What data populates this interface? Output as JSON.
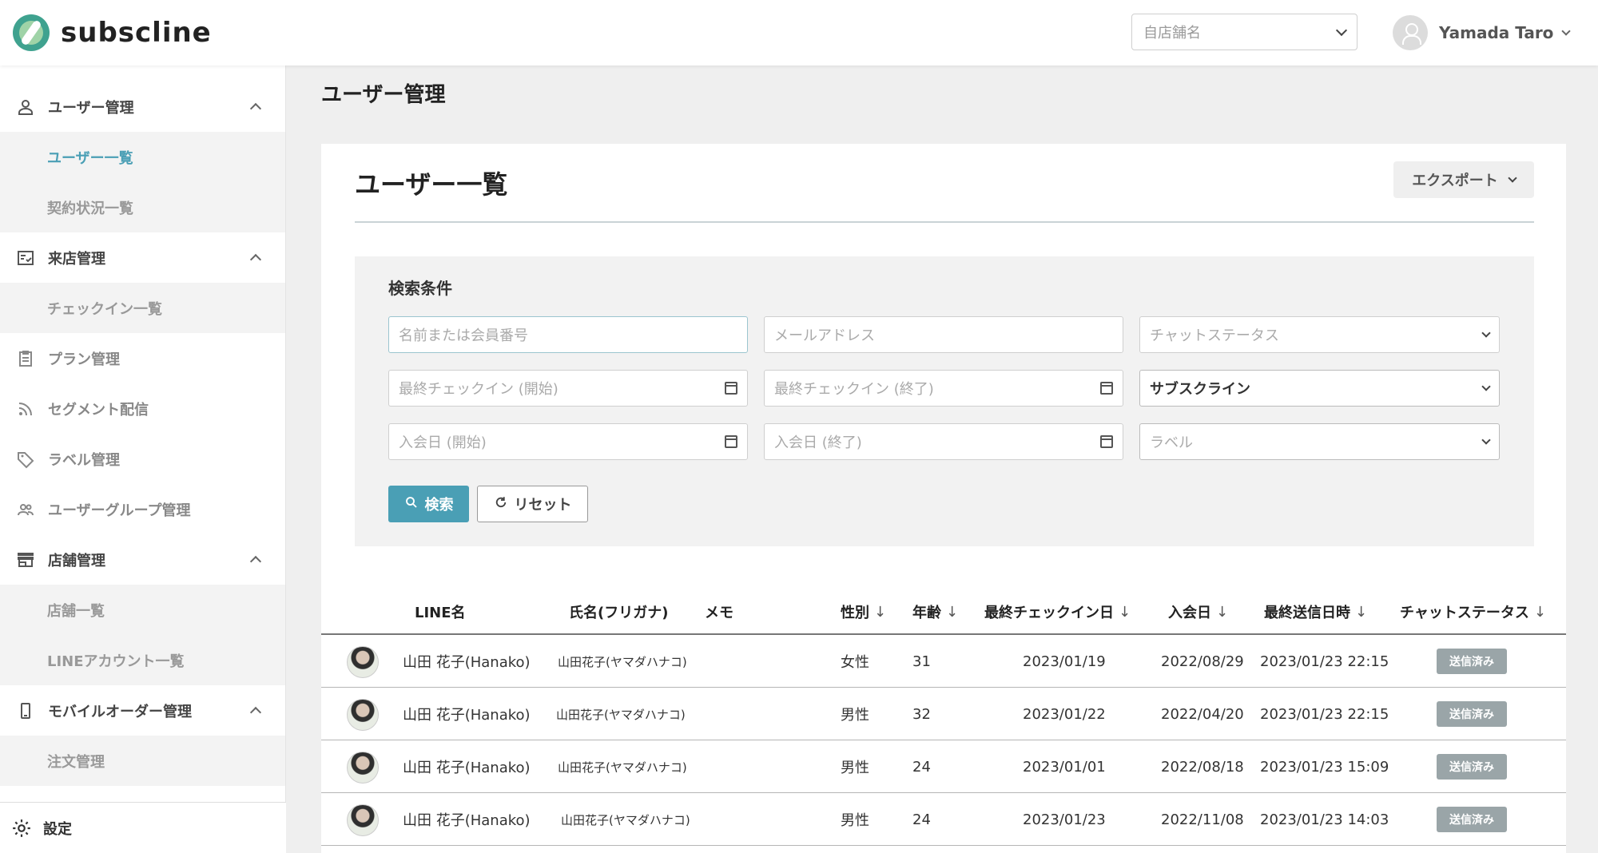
{
  "header": {
    "logo_text": "subscline",
    "store_placeholder": "自店舗名",
    "user_name": "Yamada Taro"
  },
  "sidebar": {
    "groups": [
      {
        "label": "ユーザー管理",
        "icon": "person-icon",
        "subs": [
          "ユーザー一覧",
          "契約状況一覧"
        ]
      },
      {
        "label": "来店管理",
        "icon": "checklist-icon",
        "subs": [
          "チェックイン一覧"
        ]
      },
      {
        "label": "店舗管理",
        "icon": "store-icon",
        "subs": [
          "店舗一覧",
          "LINEアカウント一覧"
        ]
      },
      {
        "label": "モバイルオーダー管理",
        "icon": "mobile-icon",
        "subs": [
          "注文管理"
        ]
      }
    ],
    "items": [
      "プラン管理",
      "セグメント配信",
      "ラベル管理",
      "ユーザーグループ管理"
    ],
    "settings_label": "設定"
  },
  "page": {
    "title": "ユーザー管理",
    "card_title": "ユーザー一覧",
    "export_label": "エクスポート"
  },
  "search": {
    "title": "検索条件",
    "name_placeholder": "名前または会員番号",
    "email_placeholder": "メールアドレス",
    "chat_status_placeholder": "チャットステータス",
    "last_checkin_start_placeholder": "最終チェックイン (開始)",
    "last_checkin_end_placeholder": "最終チェックイン (終了)",
    "account_value": "サブスクライン",
    "join_start_placeholder": "入会日 (開始)",
    "join_end_placeholder": "入会日 (終了)",
    "label_placeholder": "ラベル",
    "search_button": "検索",
    "reset_button": "リセット"
  },
  "table": {
    "headers": {
      "line_name": "LINE名",
      "full_name": "氏名(フリガナ)",
      "memo": "メモ",
      "gender": "性別",
      "age": "年齢",
      "last_checkin": "最終チェックイン日",
      "join_date": "入会日",
      "last_sent": "最終送信日時",
      "chat_status": "チャットステータス"
    },
    "rows": [
      {
        "line_name": "山田 花子(Hanako)",
        "full_name": "山田花子(ヤマダハナコ)",
        "memo": "",
        "gender": "女性",
        "age": "31",
        "last_checkin": "2023/01/19",
        "join_date": "2022/08/29",
        "last_sent": "2023/01/23 22:15",
        "chat_status": "送信済み"
      },
      {
        "line_name": "山田 花子(Hanako)",
        "full_name": "山田花子(ヤマダハナコ)",
        "memo": "",
        "gender": "男性",
        "age": "32",
        "last_checkin": "2023/01/22",
        "join_date": "2022/04/20",
        "last_sent": "2023/01/23 22:15",
        "chat_status": "送信済み"
      },
      {
        "line_name": "山田 花子(Hanako)",
        "full_name": "山田花子(ヤマダハナコ)",
        "memo": "",
        "gender": "男性",
        "age": "24",
        "last_checkin": "2023/01/01",
        "join_date": "2022/08/18",
        "last_sent": "2023/01/23 15:09",
        "chat_status": "送信済み"
      },
      {
        "line_name": "山田 花子(Hanako)",
        "full_name": "山田花子(ヤマダハナコ)",
        "memo": "",
        "gender": "男性",
        "age": "24",
        "last_checkin": "2023/01/23",
        "join_date": "2022/11/08",
        "last_sent": "2023/01/23 14:03",
        "chat_status": "送信済み"
      }
    ]
  },
  "colors": {
    "accent": "#4a9fb5",
    "badge": "#9aa5a8",
    "background": "#efefef"
  }
}
